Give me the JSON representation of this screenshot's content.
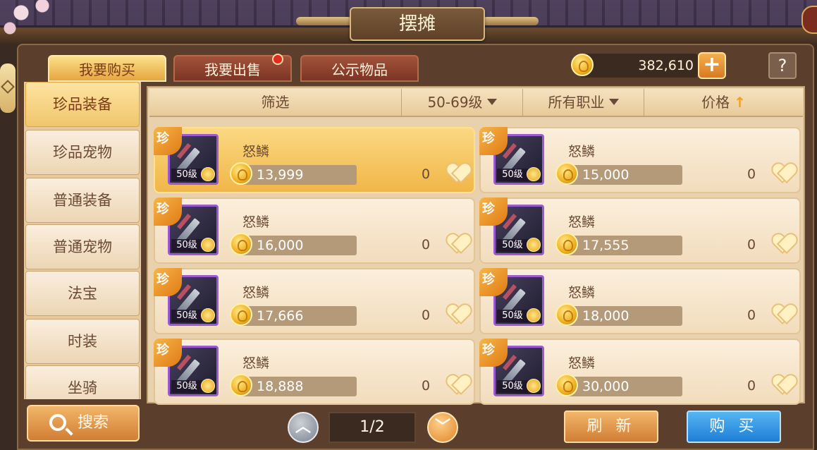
{
  "title": "摆摊",
  "tabs": [
    {
      "label": "我要购买",
      "active": true
    },
    {
      "label": "我要出售",
      "active": false,
      "has_notification": true
    },
    {
      "label": "公示物品",
      "active": false
    }
  ],
  "currency": {
    "amount": "382,610",
    "add_label": "+"
  },
  "help_label": "?",
  "categories": [
    {
      "label": "珍品装备",
      "active": true
    },
    {
      "label": "珍品宠物"
    },
    {
      "label": "普通装备"
    },
    {
      "label": "普通宠物"
    },
    {
      "label": "法宝"
    },
    {
      "label": "时装"
    },
    {
      "label": "坐骑"
    }
  ],
  "search_label": "搜索",
  "filters": {
    "filter_label": "筛选",
    "level_label": "50-69级",
    "class_label": "所有职业",
    "price_label": "价格"
  },
  "listings": [
    {
      "tag": "珍",
      "name": "怒鳞",
      "level": "50级",
      "price": "13,999",
      "likes": "0",
      "selected": true
    },
    {
      "tag": "珍",
      "name": "怒鳞",
      "level": "50级",
      "price": "15,000",
      "likes": "0"
    },
    {
      "tag": "珍",
      "name": "怒鳞",
      "level": "50级",
      "price": "16,000",
      "likes": "0"
    },
    {
      "tag": "珍",
      "name": "怒鳞",
      "level": "50级",
      "price": "17,555",
      "likes": "0"
    },
    {
      "tag": "珍",
      "name": "怒鳞",
      "level": "50级",
      "price": "17,666",
      "likes": "0"
    },
    {
      "tag": "珍",
      "name": "怒鳞",
      "level": "50级",
      "price": "18,000",
      "likes": "0"
    },
    {
      "tag": "珍",
      "name": "怒鳞",
      "level": "50级",
      "price": "18,888",
      "likes": "0"
    },
    {
      "tag": "珍",
      "name": "怒鳞",
      "level": "50级",
      "price": "30,000",
      "likes": "0"
    }
  ],
  "pagination": {
    "current": "1/2"
  },
  "refresh_label": "刷 新",
  "buy_label": "购 买",
  "colors": {
    "accent": "#f0b648",
    "buy": "#1e7ed6",
    "rare": "#9a5ad2"
  }
}
